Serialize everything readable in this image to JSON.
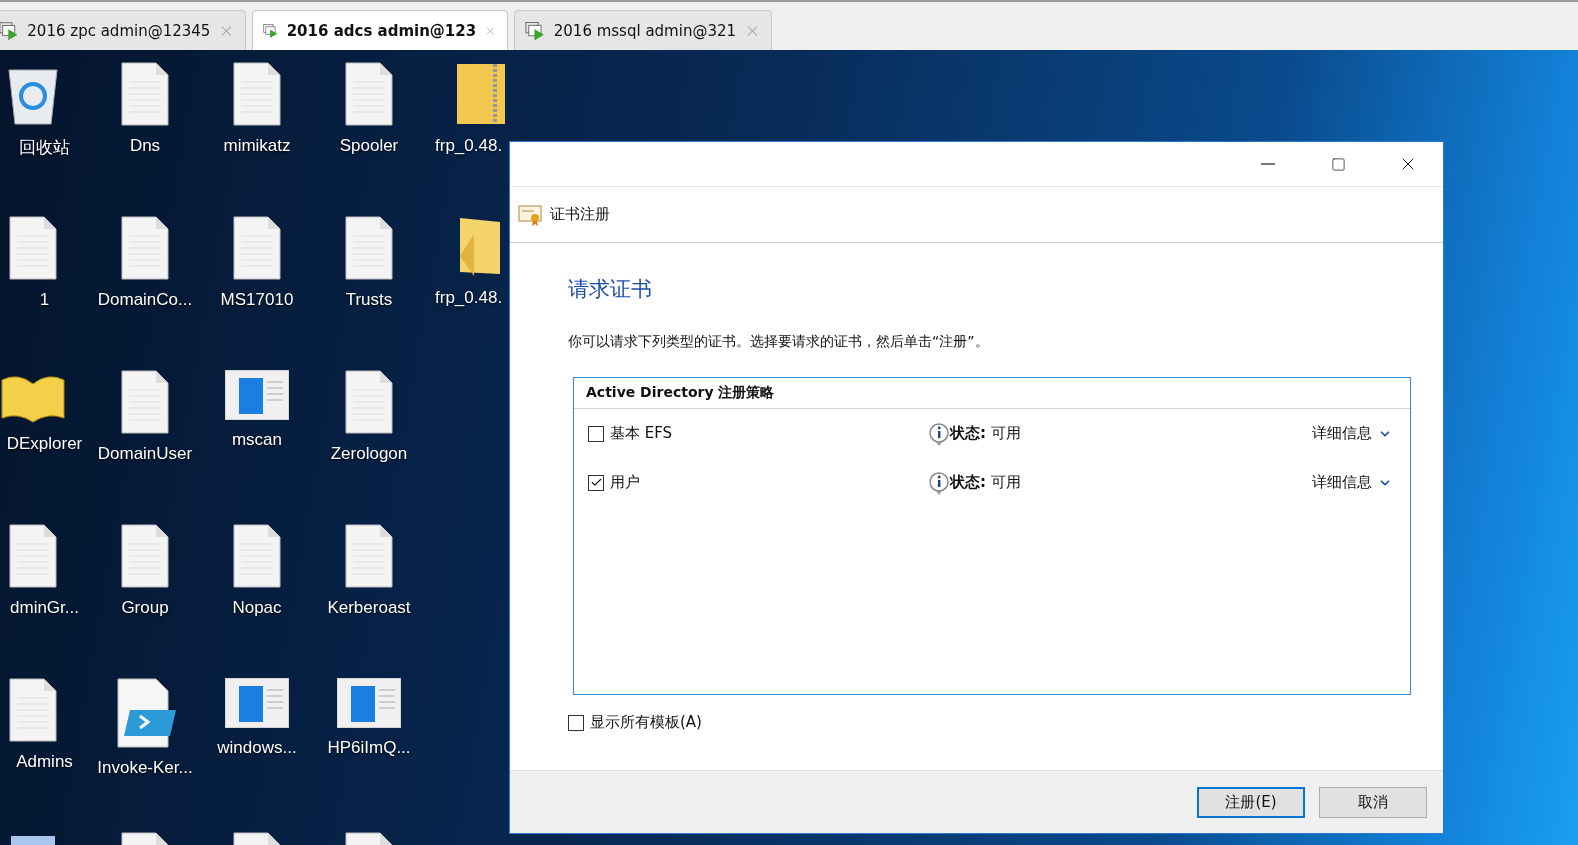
{
  "tabs": [
    {
      "label": "2016 zpc admin@12345",
      "selected": false
    },
    {
      "label": "2016 adcs admin@123",
      "selected": true
    },
    {
      "label": "2016 mssql admin@321",
      "selected": false
    }
  ],
  "desktop_icons": [
    {
      "label": "回收站",
      "kind": "recycle"
    },
    {
      "label": "Dns",
      "kind": "doc"
    },
    {
      "label": "mimikatz",
      "kind": "doc"
    },
    {
      "label": "Spooler",
      "kind": "doc"
    },
    {
      "label": "frp_0.48.",
      "kind": "zip"
    },
    {
      "label": "1",
      "kind": "doc"
    },
    {
      "label": "DomainCo...",
      "kind": "doc"
    },
    {
      "label": "MS17010",
      "kind": "doc"
    },
    {
      "label": "Trusts",
      "kind": "doc"
    },
    {
      "label": "frp_0.48.",
      "kind": "folder"
    },
    {
      "label": "DExplorer",
      "kind": "book"
    },
    {
      "label": "DomainUser",
      "kind": "doc"
    },
    {
      "label": "mscan",
      "kind": "app"
    },
    {
      "label": "Zerologon",
      "kind": "doc"
    },
    {
      "kind": "none"
    },
    {
      "label": "dminGr...",
      "kind": "doc"
    },
    {
      "label": "Group",
      "kind": "doc"
    },
    {
      "label": "Nopac",
      "kind": "doc"
    },
    {
      "label": "Kerberoast",
      "kind": "doc"
    },
    {
      "kind": "none"
    },
    {
      "label": "Admins",
      "kind": "doc"
    },
    {
      "label": "Invoke-Ker...",
      "kind": "script"
    },
    {
      "label": "windows...",
      "kind": "app"
    },
    {
      "label": "HP6iImQ...",
      "kind": "app"
    },
    {
      "kind": "none"
    },
    {
      "kind": "shortcut"
    },
    {
      "kind": "doc"
    },
    {
      "kind": "doc"
    },
    {
      "kind": "doc"
    },
    {
      "kind": "none"
    }
  ],
  "dialog": {
    "title": "证书注册",
    "heading": "请求证书",
    "description": "你可以请求下列类型的证书。选择要请求的证书，然后单击“注册”。",
    "policy": {
      "title": "Active Directory 注册策略",
      "items": [
        {
          "name": "基本 EFS",
          "checked": false,
          "status": "**状态:** 可用",
          "details": "详细信息"
        },
        {
          "name": "用户",
          "checked": true,
          "status": "**状态:** 可用",
          "details": "详细信息"
        }
      ]
    },
    "show_all": {
      "label": "显示所有模板(A)",
      "checked": false
    },
    "buttons": [
      {
        "label": "注册(E)",
        "selected": true
      },
      {
        "label": "取消",
        "selected": false
      }
    ]
  }
}
